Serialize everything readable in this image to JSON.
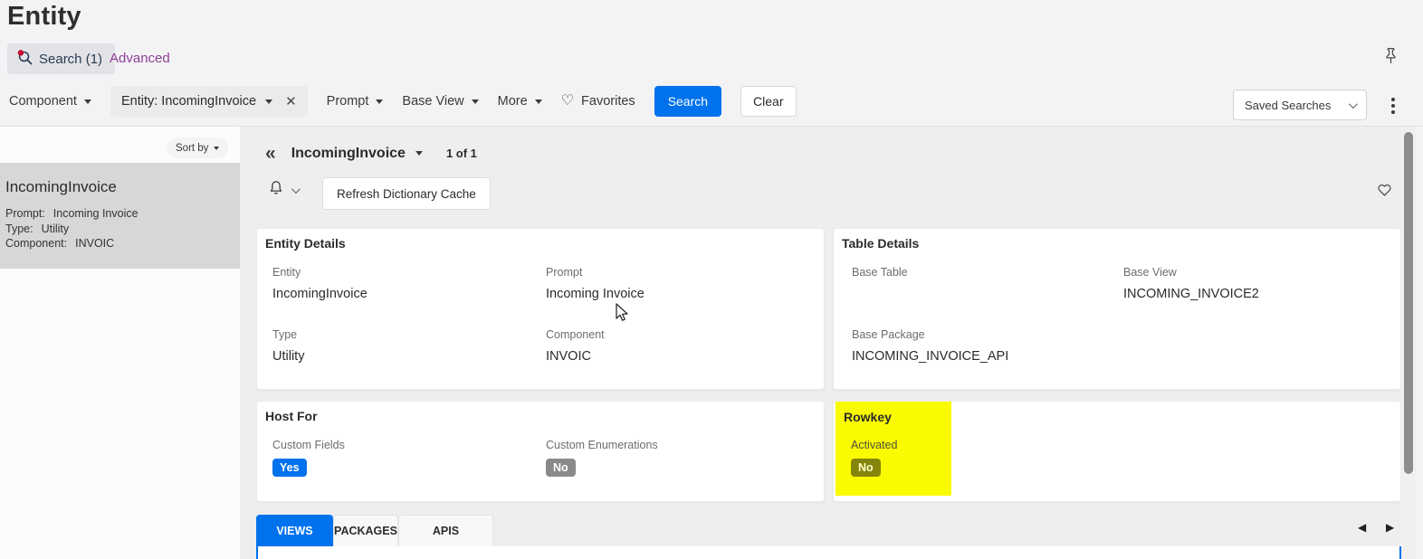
{
  "page": {
    "title": "Entity"
  },
  "top_tabs": {
    "search_label": "Search (1)",
    "advanced_label": "Advanced"
  },
  "filter_bar": {
    "component_label": "Component",
    "active_filter_chip": "Entity: IncomingInvoice",
    "prompt_label": "Prompt",
    "base_view_label": "Base View",
    "more_label": "More",
    "favorites_label": "Favorites",
    "search_button_label": "Search",
    "clear_button_label": "Clear",
    "saved_searches_label": "Saved Searches"
  },
  "sidebar": {
    "sort_by_label": "Sort by",
    "result_card": {
      "title": "IncomingInvoice",
      "rows": [
        {
          "label": "Prompt:",
          "value": "Incoming Invoice"
        },
        {
          "label": "Type:",
          "value": "Utility"
        },
        {
          "label": "Component:",
          "value": "INVOIC"
        }
      ]
    }
  },
  "record_header": {
    "title": "IncomingInvoice",
    "pager": "1 of 1",
    "refresh_button_label": "Refresh Dictionary Cache"
  },
  "cards": {
    "entity_details": {
      "title": "Entity Details",
      "entity": {
        "label": "Entity",
        "value": "IncomingInvoice"
      },
      "prompt": {
        "label": "Prompt",
        "value": "Incoming Invoice"
      },
      "type": {
        "label": "Type",
        "value": "Utility"
      },
      "component": {
        "label": "Component",
        "value": "INVOIC"
      }
    },
    "table_details": {
      "title": "Table Details",
      "base_table": {
        "label": "Base Table",
        "value": ""
      },
      "base_view": {
        "label": "Base View",
        "value": "INCOMING_INVOICE2"
      },
      "base_package": {
        "label": "Base Package",
        "value": "INCOMING_INVOICE_API"
      }
    },
    "host_for": {
      "title": "Host For",
      "custom_fields": {
        "label": "Custom Fields",
        "badge": "Yes"
      },
      "custom_enumerations": {
        "label": "Custom Enumerations",
        "badge": "No"
      }
    },
    "rowkey": {
      "title": "Rowkey",
      "activated": {
        "label": "Activated",
        "badge": "No"
      }
    }
  },
  "bottom_tabs": {
    "views": "VIEWS",
    "packages": "PACKAGES",
    "apis": "APIS"
  },
  "icons": {
    "close": "✕",
    "collapse": "«",
    "heart": "♡",
    "tab_left": "◀",
    "tab_right": "▶"
  },
  "colors": {
    "accent_blue": "#0072ed",
    "highlight_yellow": "#fafa00",
    "badge_gray": "#8a8a8a",
    "advanced_purple": "#8f3f97",
    "search_icon_red": "#c8102e",
    "selected_result_gray": "#d7d7d7"
  }
}
